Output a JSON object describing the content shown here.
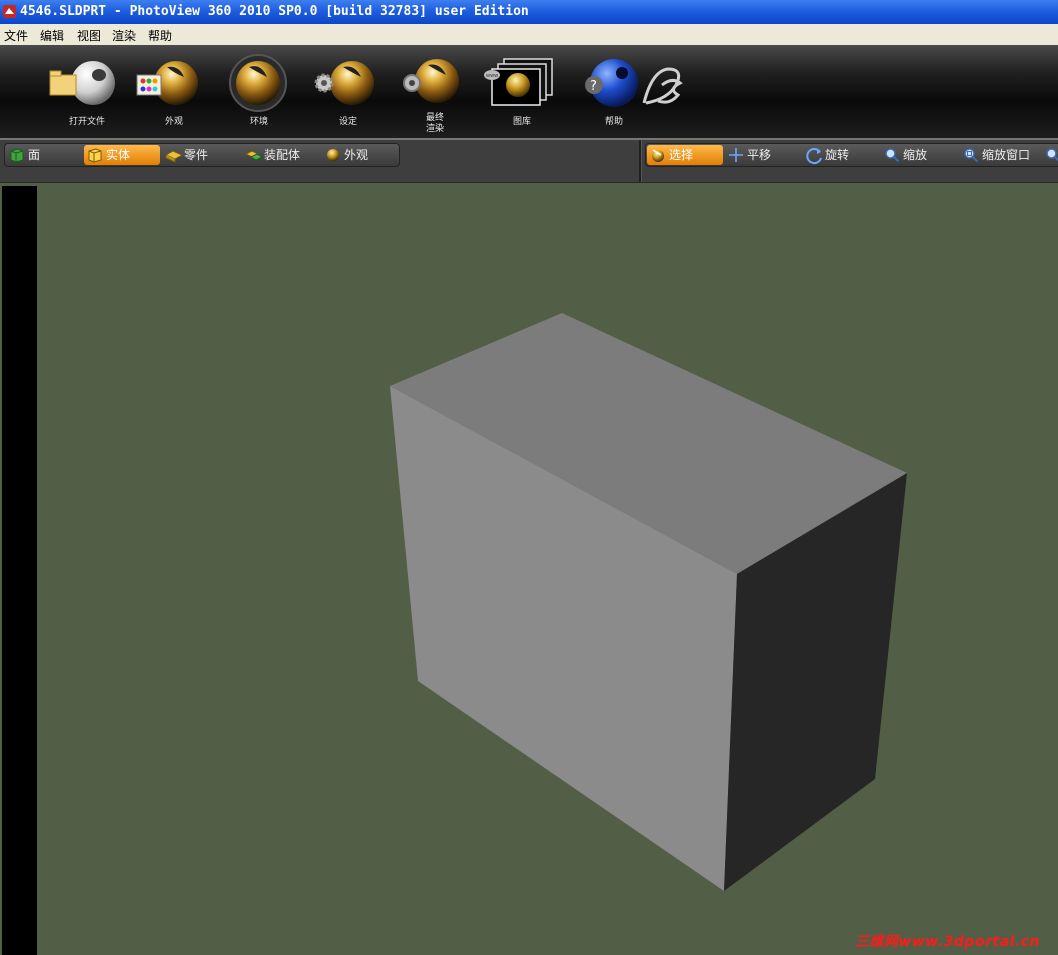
{
  "window": {
    "title": "4546.SLDPRT - PhotoView 360 2010 SP0.0 [build 32783] user Edition"
  },
  "menu": {
    "items": [
      "文件",
      "编辑",
      "视图",
      "渲染",
      "帮助"
    ]
  },
  "ribbon": {
    "buttons": [
      {
        "label": "打开文件",
        "icon": "open-file-icon"
      },
      {
        "label": "外观",
        "icon": "appearance-icon"
      },
      {
        "label": "环境",
        "icon": "environment-icon"
      },
      {
        "label": "设定",
        "icon": "settings-icon"
      },
      {
        "label": "最终\n渲染",
        "label_line1": "最终",
        "label_line2": "渲染",
        "icon": "final-render-icon"
      },
      {
        "label": "图库",
        "icon": "gallery-icon"
      },
      {
        "label": "帮助",
        "icon": "help-icon"
      }
    ],
    "brand_icon": "ds-logo"
  },
  "selection_filter": {
    "items": [
      {
        "label": "面",
        "icon": "face-icon",
        "active": false
      },
      {
        "label": "实体",
        "icon": "solid-body-icon",
        "active": true
      },
      {
        "label": "零件",
        "icon": "part-icon",
        "active": false
      },
      {
        "label": "装配体",
        "icon": "assembly-icon",
        "active": false
      },
      {
        "label": "外观",
        "icon": "appearance-sphere-icon",
        "active": false
      }
    ]
  },
  "view_tools": {
    "items": [
      {
        "label": "选择",
        "icon": "select-icon",
        "active": true
      },
      {
        "label": "平移",
        "icon": "pan-icon",
        "active": false
      },
      {
        "label": "旋转",
        "icon": "rotate-icon",
        "active": false
      },
      {
        "label": "缩放",
        "icon": "zoom-icon",
        "active": false
      },
      {
        "label": "缩放窗口",
        "icon": "zoom-window-icon",
        "active": false
      }
    ]
  },
  "viewport": {
    "background": "#535e46",
    "model": "box"
  },
  "watermark": "三维网www.3dportal.cn",
  "colors": {
    "accent": "#f39a1e",
    "titlebar": "#1f5ede",
    "menubar": "#ece9d8"
  }
}
